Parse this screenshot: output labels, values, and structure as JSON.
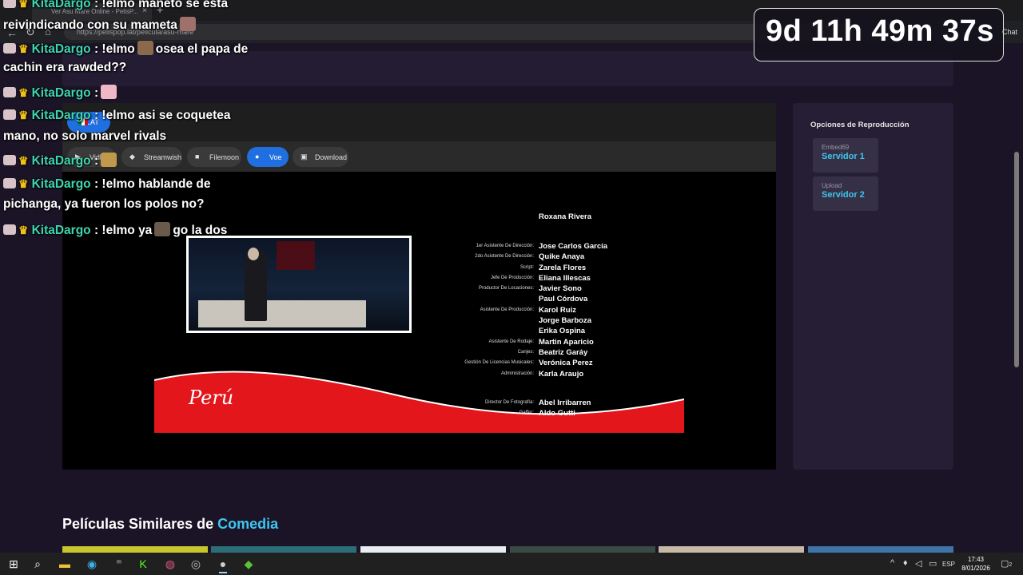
{
  "browser": {
    "tab_title": "Ver Asu Mare Online - PelisP...",
    "url": "https://pelispop.lat/pelicula/asu-mare",
    "tab_close": "×",
    "new_tab": "+",
    "back": "←",
    "reload": "↻",
    "home": "⌂",
    "download": "↓"
  },
  "player": {
    "language_label": "LAT",
    "servers": [
      {
        "label": "Vidhide",
        "icon": "play-icon",
        "active": false
      },
      {
        "label": "Streamwish",
        "icon": "stream-icon",
        "active": false
      },
      {
        "label": "Filemoon",
        "icon": "moon-icon",
        "active": false
      },
      {
        "label": "Voe",
        "icon": "dot-icon",
        "active": true
      },
      {
        "label": "Download",
        "icon": "download-icon",
        "active": false
      }
    ],
    "credits": [
      {
        "role": "",
        "name": "Roxana Rivera"
      },
      {
        "role": "1er Asistente De Dirección:",
        "name": "Jose Carlos García"
      },
      {
        "role": "2do Asistente De Dirección:",
        "name": "Quike Anaya"
      },
      {
        "role": "Script:",
        "name": "Zarela Flores"
      },
      {
        "role": "Jefe De Producción:",
        "name": "Eliana Illescas"
      },
      {
        "role": "Productor De Locaciones:",
        "name": "Javier Sono"
      },
      {
        "role": "",
        "name": "Paul Córdova"
      },
      {
        "role": "Asistente De Producción:",
        "name": "Karol Ruiz"
      },
      {
        "role": "",
        "name": "Jorge Barboza"
      },
      {
        "role": "",
        "name": "Erika Ospina"
      },
      {
        "role": "Asistente De Rodaje:",
        "name": "Martin Aparicio"
      },
      {
        "role": "Canjes:",
        "name": "Beatriz Garáy"
      },
      {
        "role": "Gestión De Licencias Musicales:",
        "name": "Verónica Perez"
      },
      {
        "role": "Administración:",
        "name": "Karla Araujo"
      },
      {
        "role": "Director De Fotografía:",
        "name": "Abel Irribarren"
      },
      {
        "role": "Gaffer:",
        "name": "Aldo Gutti"
      }
    ],
    "logo_text": "Perú"
  },
  "sidebar": {
    "title": "Opciones de Reproducción",
    "options": [
      {
        "provider": "Embed69",
        "label": "Servidor 1"
      },
      {
        "provider": "Upload",
        "label": "Servidor 2"
      }
    ]
  },
  "similar": {
    "title_prefix": "Películas Similares de ",
    "title_genre": "Comedia",
    "thumb_colors": [
      "#c9c52e",
      "#2b6e7a",
      "#e9edf2",
      "#3a4a44",
      "#c7b9a6",
      "#3e74a8"
    ]
  },
  "chat": {
    "messages": [
      {
        "user": "KitaDargo",
        "text": ": !elmo maneto se esta",
        "emote": false
      },
      {
        "user": "",
        "text": "reivindicando con su mameta",
        "emote": true
      },
      {
        "user": "KitaDargo",
        "text": ": !elmo",
        "emote": true,
        "after": "osea el papa de"
      },
      {
        "user": "",
        "text": "cachin era rawded??",
        "emote": false
      },
      {
        "user": "KitaDargo",
        "text": ":",
        "emote": true
      },
      {
        "user": "KitaDargo",
        "text": ": !elmo asi se coquetea",
        "emote": false
      },
      {
        "user": "",
        "text": "mano, no solo marvel rivals",
        "emote": false
      },
      {
        "user": "KitaDargo",
        "text": ":",
        "emote": true
      },
      {
        "user": "KitaDargo",
        "text": ": !elmo hablande de",
        "emote": false
      },
      {
        "user": "",
        "text": "pichanga, ya fueron los polos no?",
        "emote": false
      },
      {
        "user": "KitaDargo",
        "text": ": !elmo ya",
        "emote": true,
        "after": "go la dos"
      }
    ]
  },
  "timer": {
    "value": "9d 11h 49m 37s",
    "chat_label": "Chat"
  },
  "taskbar": {
    "language": "ESP",
    "time": "17:43",
    "date": "8/01/2026",
    "notifications": "2"
  }
}
